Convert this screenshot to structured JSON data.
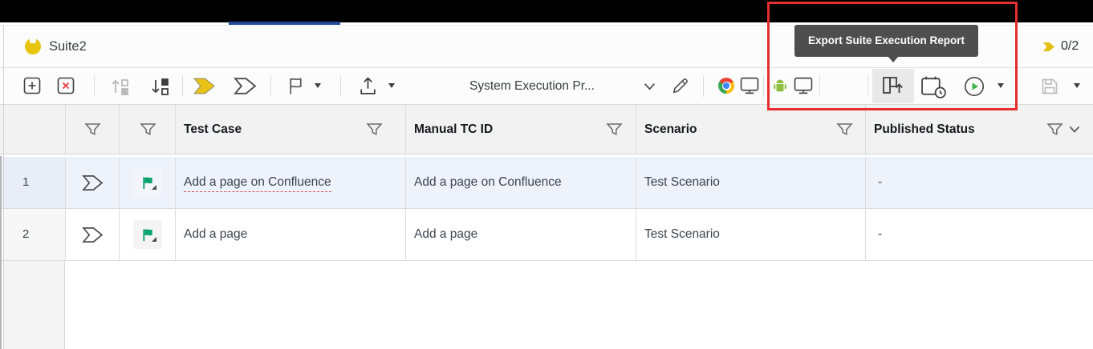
{
  "suite_header": {
    "title": "Suite2",
    "execution_count": "0/2"
  },
  "toolbar": {
    "profile_name": "System Execution Pr..."
  },
  "tooltip": {
    "text": "Export Suite Execution Report"
  },
  "table": {
    "headers": {
      "test_case": "Test Case",
      "manual_tc_id": "Manual TC ID",
      "scenario": "Scenario",
      "published_status": "Published Status"
    },
    "rows": [
      {
        "num": "1",
        "test_case": "Add a page on Confluence",
        "manual_tc_id": "Add a page on Confluence",
        "scenario": "Test Scenario",
        "published_status": "-"
      },
      {
        "num": "2",
        "test_case": "Add a page",
        "manual_tc_id": "Add a page",
        "scenario": "Test Scenario",
        "published_status": "-"
      }
    ]
  },
  "colors": {
    "highlight_red": "#e62e2e",
    "brand_yellow": "#e8c40e",
    "flag_green": "#0ca36e",
    "play_green": "#3fb24b",
    "selected_row_blue": "#edf2fb",
    "tab_accent_blue": "#24489b"
  },
  "icons": {
    "suite-icon": "yellow-circle-badge",
    "add-row-icon": "plus-in-square",
    "delete-row-icon": "x-in-square",
    "move-up-icon": "arrow-up-with-squares",
    "move-down-icon": "arrow-down-with-squares",
    "run-selected-icon": "yellow-chevron-banner",
    "run-outline-icon": "outline-chevron-banner",
    "flag-icon": "flag-outline",
    "export-upload-icon": "arrow-up-from-tray",
    "profile-edit-icon": "pencil",
    "chrome-icon": "chrome-logo",
    "desktop-icon": "monitor",
    "android-icon": "android-robot",
    "export-report-icon": "bar-chart-with-up-arrow",
    "schedule-icon": "calendar-with-clock",
    "run-now-icon": "play-in-circle",
    "save-icon": "floppy-disk",
    "filter-icon": "funnel",
    "row-flag-icon": "green-flag"
  }
}
